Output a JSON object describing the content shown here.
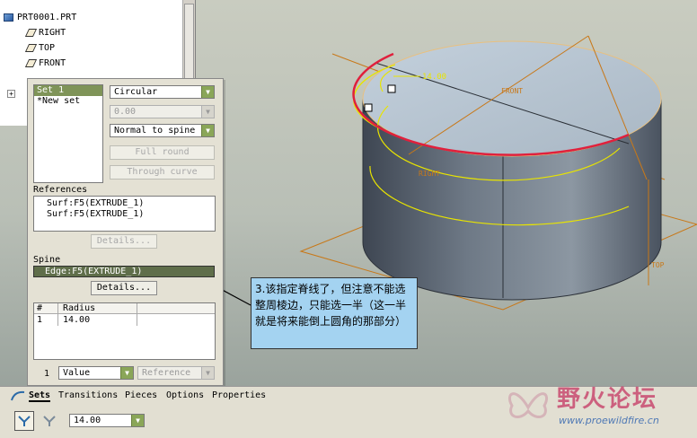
{
  "tree": {
    "items": [
      {
        "label": "PRT0001.PRT",
        "icon": "part-icon"
      },
      {
        "label": "RIGHT",
        "icon": "datum-plane-icon"
      },
      {
        "label": "TOP",
        "icon": "datum-plane-icon"
      },
      {
        "label": "FRONT",
        "icon": "datum-plane-icon"
      }
    ]
  },
  "round_panel": {
    "sets": [
      "Set 1",
      "*New set"
    ],
    "shape_type": "Circular",
    "value_disabled": "0.00",
    "cross_section": "Normal to spine",
    "full_round_label": "Full round",
    "through_curve_label": "Through curve",
    "references_label": "References",
    "references": [
      "Surf:F5(EXTRUDE_1)",
      "Surf:F5(EXTRUDE_1)"
    ],
    "details_label": "Details...",
    "spine_label": "Spine",
    "spine_value": "Edge:F5(EXTRUDE_1)",
    "table_headers": {
      "num": "#",
      "radius": "Radius"
    },
    "table_rows": [
      {
        "num": "1",
        "radius": "14.00"
      }
    ],
    "point_index": "1",
    "value_mode": "Value",
    "reference_mode": "Reference"
  },
  "viewport": {
    "dimension_label": "14.00",
    "datum_labels": {
      "front": "FRONT",
      "right": "RIGHT",
      "top": "TOP"
    }
  },
  "callout": {
    "text": "3.该指定脊线了，但注意不能选整周棱边，只能选一半（这一半就是将来能倒上圆角的那部分）"
  },
  "tabs": [
    "Sets",
    "Transitions",
    "Pieces",
    "Options",
    "Properties"
  ],
  "toolbar": {
    "radius_value": "14.00",
    "icons": [
      "round-set-mode-icon",
      "transition-mode-icon"
    ]
  },
  "watermark": {
    "name": "野火论坛",
    "url": "www.proewildfire.cn"
  },
  "colors": {
    "selected_edge": "#e0203c",
    "preview_geometry": "#e8e400",
    "datum_plane": "#c87818",
    "cylinder_top": "#b6c3cf",
    "callout_bg": "#a4d3f1",
    "active_arrow": "#8aa658"
  }
}
